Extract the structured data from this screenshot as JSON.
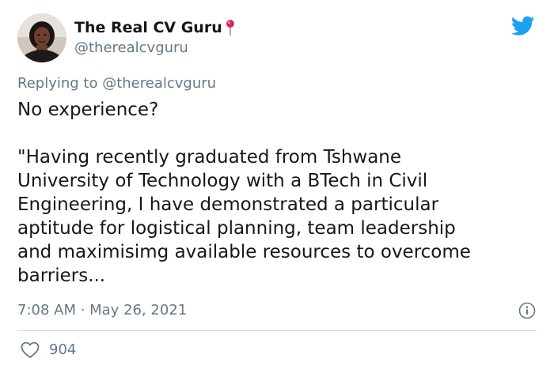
{
  "author": {
    "name": "The Real CV Guru",
    "handle": "@therealcvguru",
    "avatar_icon": "profile-photo",
    "name_emoji_icon": "round-pushpin-icon"
  },
  "reply": {
    "prefix": "Replying to ",
    "mention": "@therealcvguru"
  },
  "tweet": {
    "line1": "No experience?",
    "paragraph": "\"Having recently graduated from Tshwane\nUniversity of Technology with a BTech in Civil\nEngineering, I have demonstrated a particular\naptitude for logistical planning, team leadership\nand maximisimg available resources to overcome\nbarriers..."
  },
  "meta": {
    "timestamp": "7:08 AM · May 26, 2021"
  },
  "actions": {
    "like_count": "904"
  },
  "colors": {
    "twitter_blue": "#1da1f2",
    "text_primary": "#14171a",
    "text_secondary": "#657786",
    "divider": "#cfd9de"
  },
  "icons": {
    "logo": "twitter-bird-icon",
    "info": "info-icon",
    "like": "heart-icon"
  }
}
